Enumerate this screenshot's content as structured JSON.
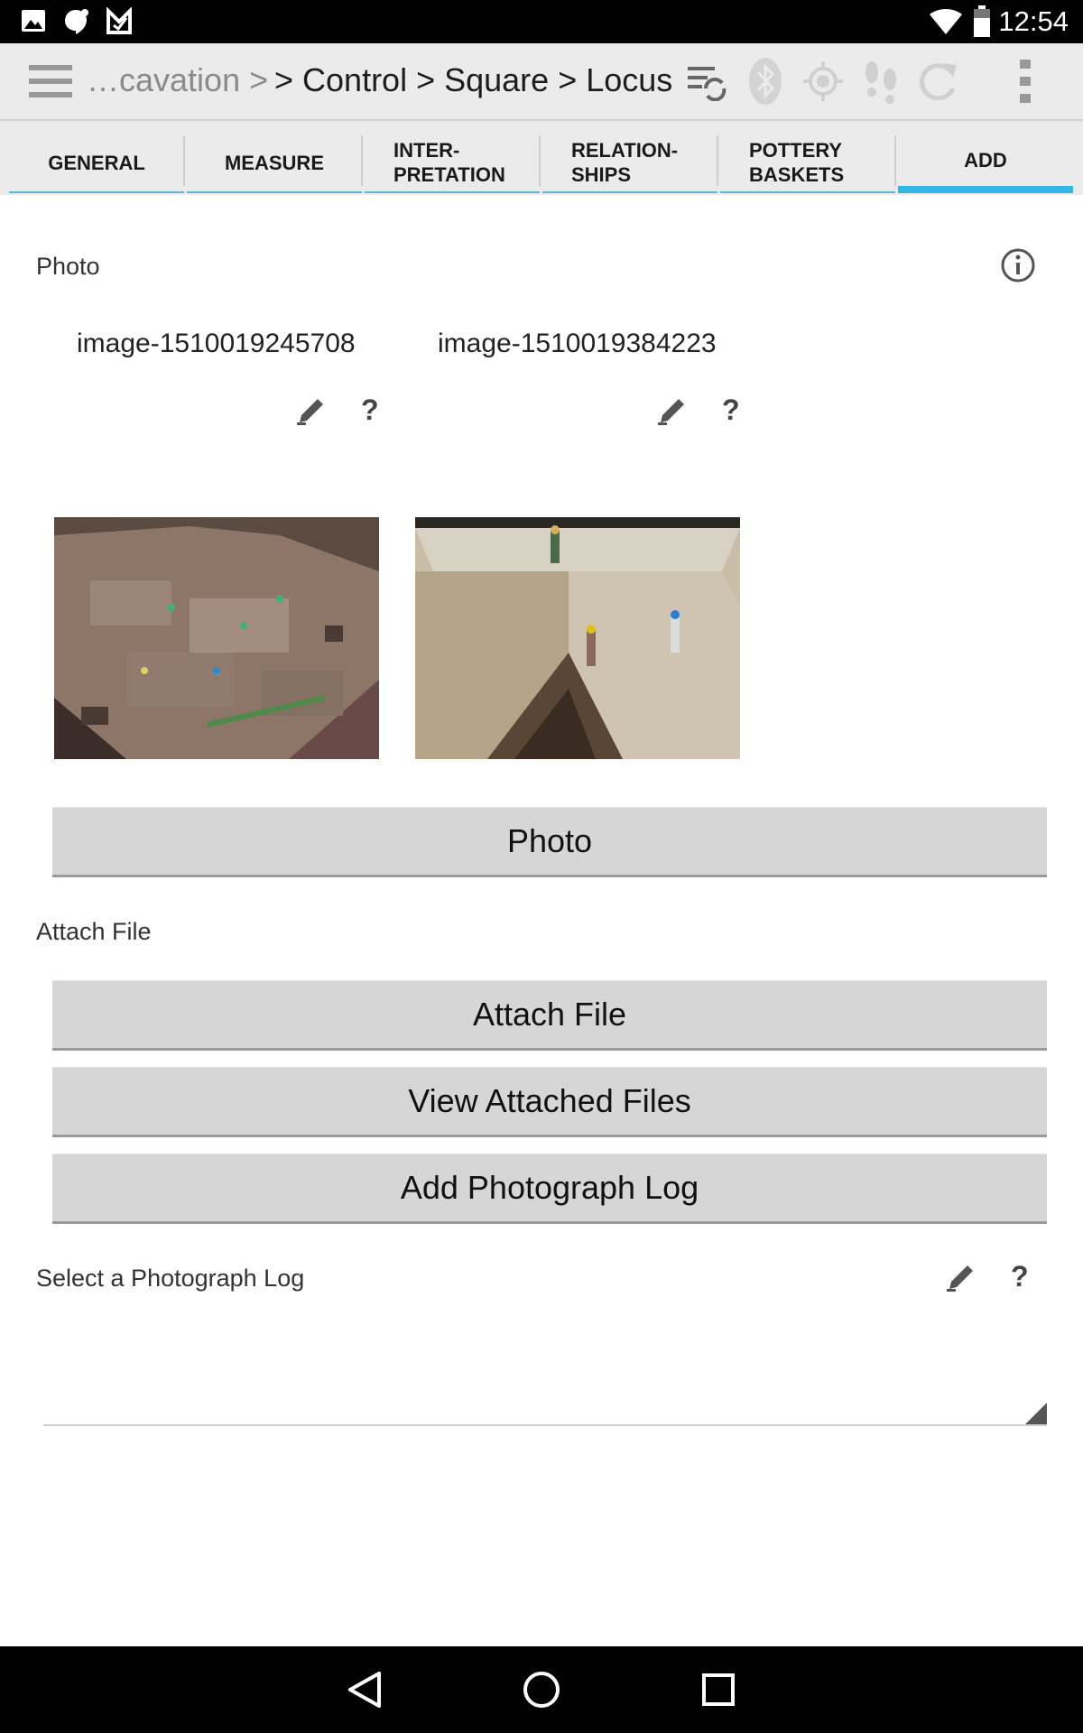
{
  "status_bar": {
    "time": "12:54",
    "left_icons": [
      "image-icon",
      "hangouts-icon",
      "check-icon"
    ],
    "right_icons": [
      "wifi-icon",
      "battery-icon"
    ]
  },
  "action_bar": {
    "breadcrumb_dim": "…cavation >",
    "breadcrumb": "> Control > Square > Locus",
    "icons": [
      "menu-icon",
      "sync-list-icon",
      "bluetooth-icon",
      "gps-icon",
      "footsteps-icon",
      "refresh-icon",
      "overflow-menu-icon"
    ]
  },
  "tabs": [
    {
      "line1": "GENERAL",
      "line2": ""
    },
    {
      "line1": "MEASURE",
      "line2": ""
    },
    {
      "line1": "INTER-",
      "line2": "PRETATION"
    },
    {
      "line1": "RELATION-",
      "line2": "SHIPS"
    },
    {
      "line1": "POTTERY",
      "line2": "BASKETS"
    },
    {
      "line1": "ADD",
      "line2": ""
    }
  ],
  "active_tab": "ADD",
  "colors": {
    "accent": "#33b5e5",
    "button_bg": "#d6d6d6",
    "action_bar_bg": "#ebebeb"
  },
  "photo_section": {
    "label": "Photo",
    "images": [
      {
        "name": "image-1510019245708"
      },
      {
        "name": "image-1510019384223"
      }
    ],
    "button": "Photo"
  },
  "attach_section": {
    "label": "Attach File",
    "attach_button": "Attach File",
    "view_button": "View Attached Files",
    "photo_log_button": "Add Photograph Log"
  },
  "photo_log_section": {
    "label": "Select a Photograph Log",
    "value": ""
  },
  "help_mark": "?"
}
